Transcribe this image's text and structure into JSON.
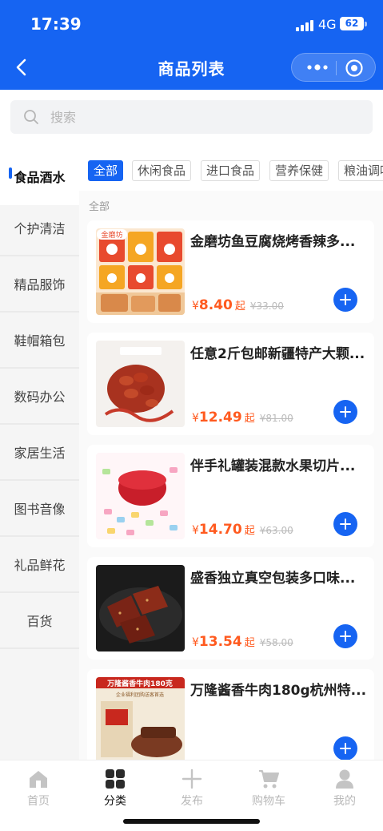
{
  "status_bar": {
    "time": "17:39",
    "network": "4G",
    "battery": "62"
  },
  "nav": {
    "title": "商品列表"
  },
  "search": {
    "placeholder": "搜索"
  },
  "sidebar": {
    "items": [
      {
        "label": "食品酒水",
        "active": true
      },
      {
        "label": "个护清洁"
      },
      {
        "label": "精品服饰"
      },
      {
        "label": "鞋帽箱包"
      },
      {
        "label": "数码办公"
      },
      {
        "label": "家居生活"
      },
      {
        "label": "图书音像"
      },
      {
        "label": "礼品鲜花"
      },
      {
        "label": "百货"
      }
    ]
  },
  "filters": {
    "chips": [
      "全部",
      "休闲食品",
      "进口食品",
      "营养保健",
      "粮油调味"
    ],
    "selected": "全部"
  },
  "section_title": "全部",
  "products": [
    {
      "name": "金磨坊鱼豆腐烧烤香辣多...",
      "currency": "¥",
      "price": "8.40",
      "suffix": "起",
      "original_price": "¥33.00"
    },
    {
      "name": "任意2斤包邮新疆特产大颗...",
      "currency": "¥",
      "price": "12.49",
      "suffix": "起",
      "original_price": "¥81.00"
    },
    {
      "name": "伴手礼罐装混款水果切片...",
      "currency": "¥",
      "price": "14.70",
      "suffix": "起",
      "original_price": "¥63.00"
    },
    {
      "name": "盛香独立真空包装多口味...",
      "currency": "¥",
      "price": "13.54",
      "suffix": "起",
      "original_price": "¥58.00"
    },
    {
      "name": "万隆酱香牛肉180g杭州特...",
      "currency": "¥",
      "price": "",
      "suffix": "",
      "original_price": ""
    }
  ],
  "product_image_text": {
    "p1_brand": "金磨坊",
    "p5_banner": "万隆酱香牛肉180克",
    "p5_sub": "企业福利团购送客首选"
  },
  "tabbar": {
    "items": [
      {
        "label": "首页",
        "icon": "home-icon"
      },
      {
        "label": "分类",
        "icon": "grid-icon",
        "active": true
      },
      {
        "label": "发布",
        "icon": "plus-icon"
      },
      {
        "label": "购物车",
        "icon": "cart-icon"
      },
      {
        "label": "我的",
        "icon": "user-icon"
      }
    ]
  },
  "colors": {
    "primary": "#1664f2",
    "price": "#ff5a1f"
  }
}
